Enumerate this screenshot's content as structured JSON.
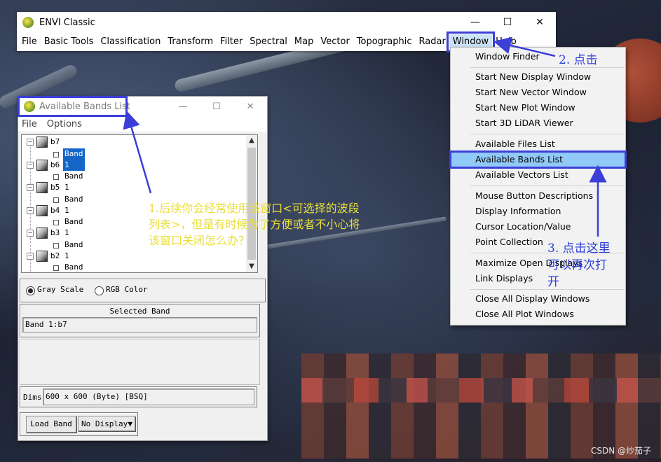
{
  "main_window": {
    "title": "ENVI Classic",
    "menu": [
      "File",
      "Basic Tools",
      "Classification",
      "Transform",
      "Filter",
      "Spectral",
      "Map",
      "Vector",
      "Topographic",
      "Radar",
      "Window",
      "Help"
    ],
    "active_menu": "Window"
  },
  "window_menu": {
    "items": [
      "Window Finder",
      "Start New Display Window",
      "Start New Vector Window",
      "Start New Plot Window",
      "Start 3D LiDAR Viewer",
      "Available Files List",
      "Available Bands List",
      "Available Vectors List",
      "Mouse Button Descriptions",
      "Display Information",
      "Cursor Location/Value",
      "Point Collection",
      "Maximize Open Displays",
      "Link Displays",
      "Close All Display Windows",
      "Close All Plot Windows"
    ],
    "highlighted": "Available Bands List"
  },
  "bands_window": {
    "title": "Available Bands List",
    "menu": [
      "File",
      "Options"
    ],
    "files": [
      {
        "name": "b7",
        "band": "Band 1"
      },
      {
        "name": "b6",
        "band": "Band 1"
      },
      {
        "name": "b5",
        "band": "Band 1"
      },
      {
        "name": "b4",
        "band": "Band 1"
      },
      {
        "name": "b3",
        "band": "Band 1"
      },
      {
        "name": "b2",
        "band": "Band 1"
      }
    ],
    "selected_band_tree_item": "Band 1",
    "mode_gray": "Gray Scale",
    "mode_rgb": "RGB Color",
    "mode_selected": "Gray Scale",
    "selected_band_heading": "Selected Band",
    "selected_band_value": "Band 1:b7",
    "dims_label": "Dims",
    "dims_value": "600 x 600 (Byte) [BSQ]",
    "load_button": "Load Band",
    "display_dropdown": "No Display"
  },
  "annotations": {
    "note1_line1": "1.后续你会经常使用该窗口<可选择的波段",
    "note1_line2": "列表>，但是有时候为了方便或者不小心将",
    "note1_line3": "该窗口关闭怎么办？",
    "note2": "2. 点击",
    "note3_line1": "3. 点击这里",
    "note3_line2": "可以再次打",
    "note3_line3": "开",
    "annotation_color": "#3b3fd8",
    "note1_color": "#e9de3a"
  },
  "watermark": "CSDN @炒茄子"
}
